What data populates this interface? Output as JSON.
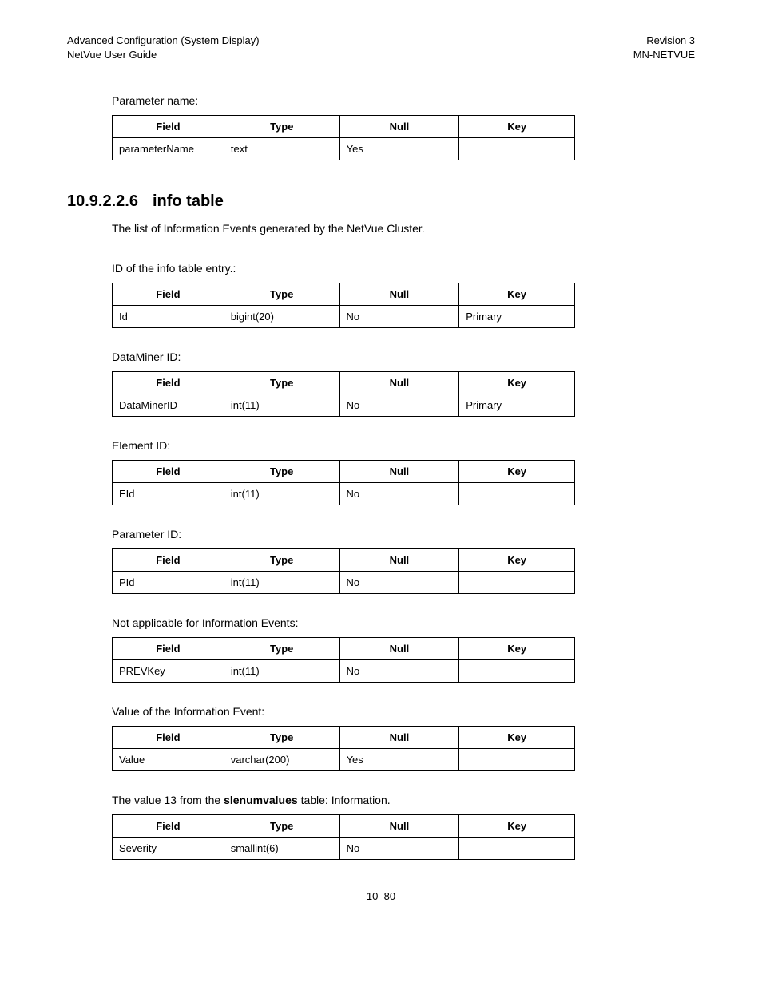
{
  "header": {
    "left1": "Advanced Configuration (System Display)",
    "left2": "NetVue User Guide",
    "right1": "Revision 3",
    "right2": "MN-NETVUE"
  },
  "intro": {
    "caption": "Parameter name:",
    "headers": {
      "field": "Field",
      "type": "Type",
      "null": "Null",
      "key": "Key"
    },
    "row": {
      "field": "parameterName",
      "type": "text",
      "null": "Yes",
      "key": ""
    }
  },
  "section": {
    "number": "10.9.2.2.6",
    "title": "info table",
    "desc": "The list of Information Events generated by the NetVue Cluster."
  },
  "tables": [
    {
      "caption": "ID of the info table entry.:",
      "row": {
        "field": "Id",
        "type": "bigint(20)",
        "null": "No",
        "key": "Primary"
      }
    },
    {
      "caption": "DataMiner ID:",
      "row": {
        "field": "DataMinerID",
        "type": "int(11)",
        "null": "No",
        "key": "Primary"
      }
    },
    {
      "caption": "Element ID:",
      "row": {
        "field": "EId",
        "type": "int(11)",
        "null": "No",
        "key": ""
      }
    },
    {
      "caption": "Parameter ID:",
      "row": {
        "field": "PId",
        "type": "int(11)",
        "null": "No",
        "key": ""
      }
    },
    {
      "caption": "Not applicable for Information Events:",
      "row": {
        "field": "PREVKey",
        "type": "int(11)",
        "null": "No",
        "key": ""
      }
    },
    {
      "caption": "Value of the Information Event:",
      "row": {
        "field": "Value",
        "type": "varchar(200)",
        "null": "Yes",
        "key": ""
      }
    }
  ],
  "lastTable": {
    "caption_pre": "The value 13 from the ",
    "caption_bold": "slenumvalues",
    "caption_post": " table: Information.",
    "row": {
      "field": "Severity",
      "type": "smallint(6)",
      "null": "No",
      "key": ""
    }
  },
  "th": {
    "field": "Field",
    "type": "Type",
    "null": "Null",
    "key": "Key"
  },
  "footer": "10–80"
}
